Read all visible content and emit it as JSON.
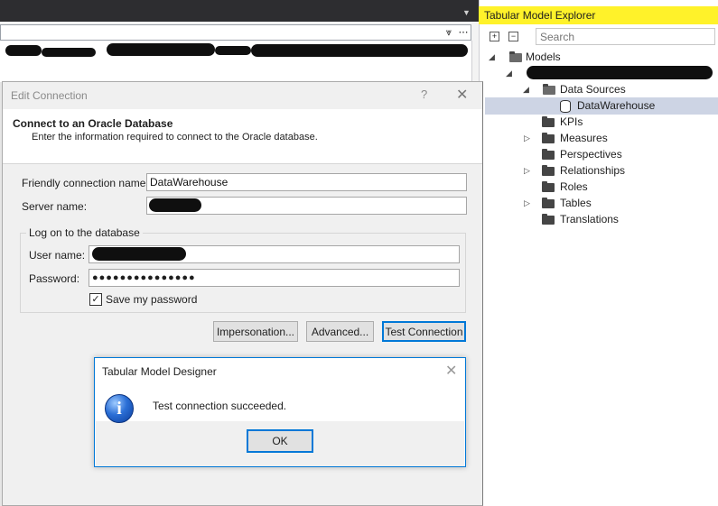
{
  "explorer": {
    "title": "Tabular Model Explorer",
    "search_placeholder": "Search",
    "expand_all": "+",
    "collapse_all": "−",
    "tree": {
      "models": "Models",
      "data_sources": "Data Sources",
      "data_warehouse": "DataWarehouse",
      "kpis": "KPIs",
      "measures": "Measures",
      "perspectives": "Perspectives",
      "relationships": "Relationships",
      "roles": "Roles",
      "tables": "Tables",
      "translations": "Translations"
    },
    "colors": {
      "title_bg": "#fff22a",
      "selected_bg": "#cdd4e4"
    }
  },
  "edit_connection": {
    "window_title": "Edit Connection",
    "help": "?",
    "close": "✕",
    "heading": "Connect to an Oracle Database",
    "subheading": "Enter the information required to connect to the Oracle database.",
    "friendly_name_label": "Friendly connection name:",
    "friendly_name_value": "DataWarehouse",
    "server_name_label": "Server name:",
    "server_name_value": "",
    "logon_group": "Log on to the database",
    "user_name_label": "User name:",
    "user_name_value": "",
    "password_label": "Password:",
    "password_value": "●●●●●●●●●●●●●●●",
    "save_password_label": "Save my password",
    "save_password_checked": "✓",
    "impersonation_button": "Impersonation...",
    "advanced_button": "Advanced...",
    "test_connection_button": "Test Connection"
  },
  "message_box": {
    "title": "Tabular Model Designer",
    "close": "✕",
    "icon_glyph": "i",
    "message": "Test connection succeeded.",
    "ok_button": "OK"
  },
  "doc_toolbar": {
    "overflow_glyph": "⩔",
    "more_glyph": "⋯"
  },
  "accent_color": "#0078d7"
}
